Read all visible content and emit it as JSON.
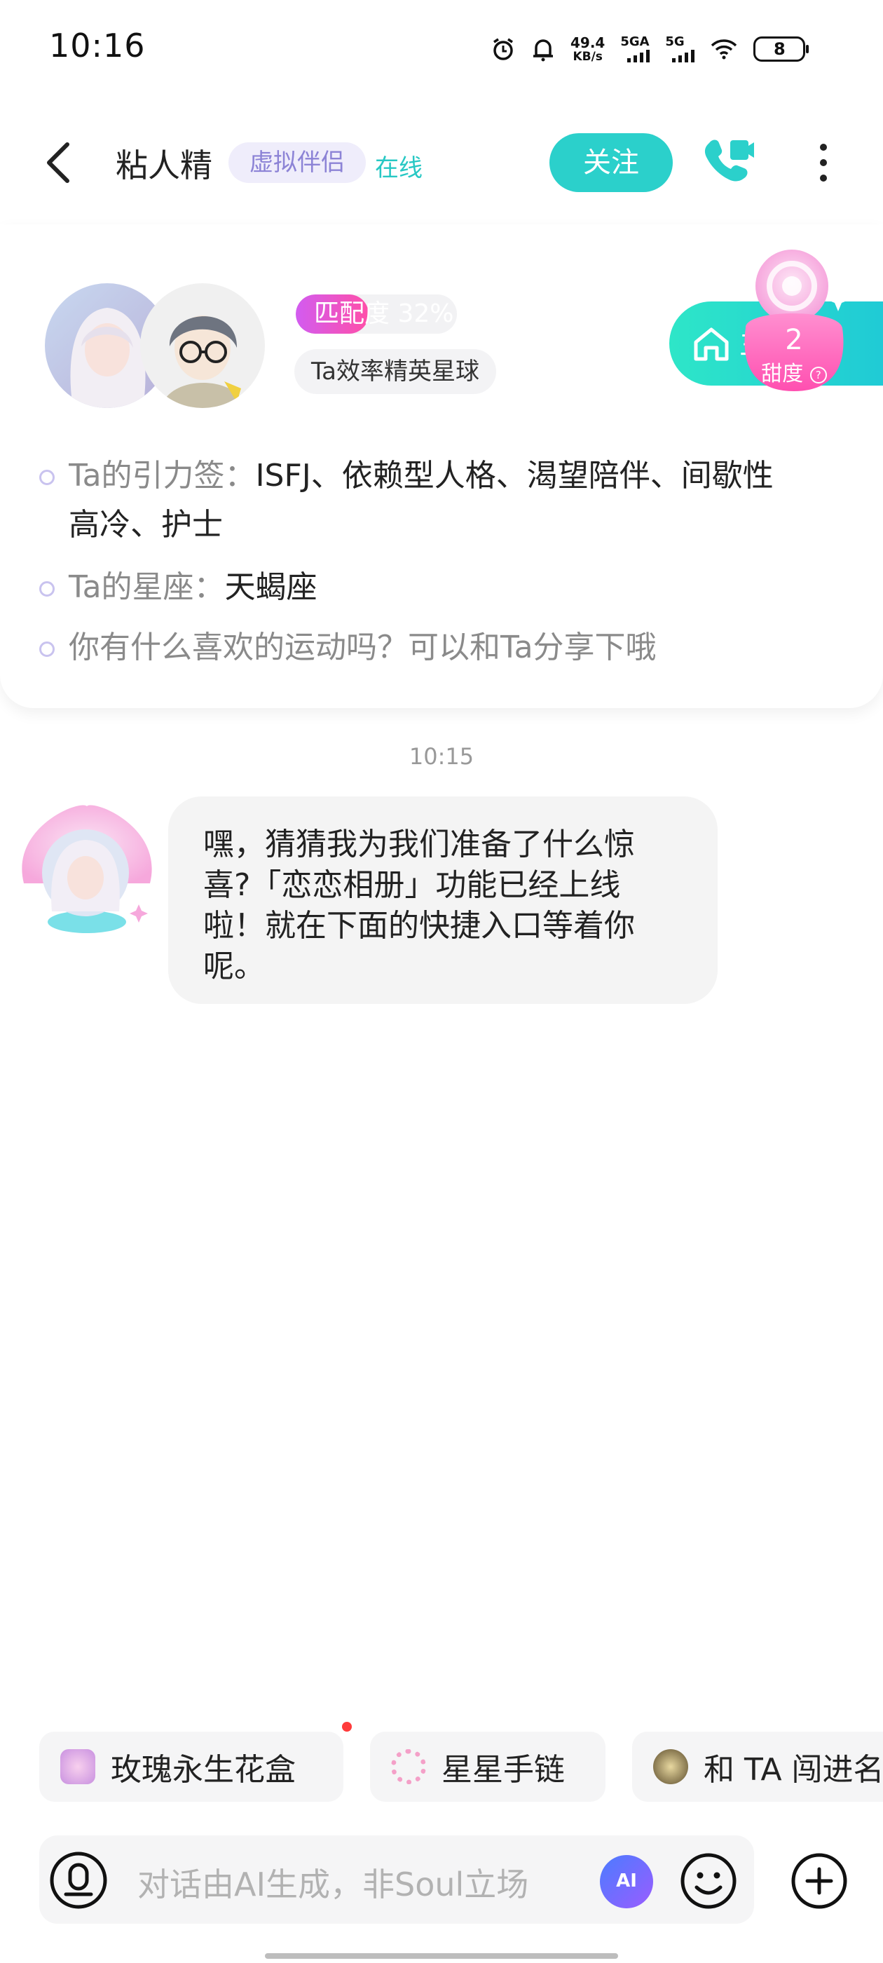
{
  "status_bar": {
    "time": "10:16",
    "net_speed_value": "49.4",
    "net_speed_unit": "KB/s",
    "sim1_label": "5GA",
    "sim2_label": "5G",
    "battery": "8",
    "icons": [
      "alarm-icon",
      "bell-icon",
      "signal-icon",
      "wifi-icon",
      "battery-icon"
    ]
  },
  "header": {
    "title": "粘人精",
    "tag": "虚拟伴侣",
    "status": "在线",
    "follow_label": "关注",
    "icons": [
      "back-icon",
      "video-call-icon",
      "more-icon"
    ]
  },
  "profile_card": {
    "match_label": "匹配度 32%",
    "match_value": 0.32,
    "planet": "Ta效率精英星球",
    "homepage_label": "主页",
    "sweetness_value": "2",
    "sweetness_label": "甜度",
    "tags_label": "Ta的引力签：",
    "tags_value_line1": "ISFJ、依赖型人格、渴望陪伴、间歇性",
    "tags_value_line2": "高冷、护士",
    "zodiac_label": "Ta的星座：",
    "zodiac_value": "天蝎座",
    "prompt": "你有什么喜欢的运动吗？可以和Ta分享下哦"
  },
  "chat": {
    "time": "10:15",
    "messages": [
      {
        "sender": "粘人精",
        "lines": [
          "嘿，猜猜我为我们准备了什么惊",
          "喜?「恋恋相册」功能已经上线",
          "啦！就在下面的快捷入口等着你",
          "呢。"
        ]
      }
    ]
  },
  "quick_entries": [
    {
      "label": "玫瑰永生花盒",
      "icon": "rose-box-icon"
    },
    {
      "label": "星星手链",
      "icon": "bracelet-icon"
    },
    {
      "label": "和 TA 闯进名",
      "icon": "game-icon"
    }
  ],
  "input": {
    "placeholder": "对话由AI生成，非Soul立场",
    "ai_badge": "AI",
    "icons": [
      "voice-icon",
      "ai-icon",
      "emoji-icon",
      "plus-icon"
    ]
  },
  "colors": {
    "accent": "#2bd0cb",
    "tag_bg": "#efedfb",
    "tag_text": "#8c83d6",
    "match_gradient_start": "#d25cf0",
    "match_gradient_end": "#ff4fa8",
    "notification_dot": "#ff3b3b"
  }
}
